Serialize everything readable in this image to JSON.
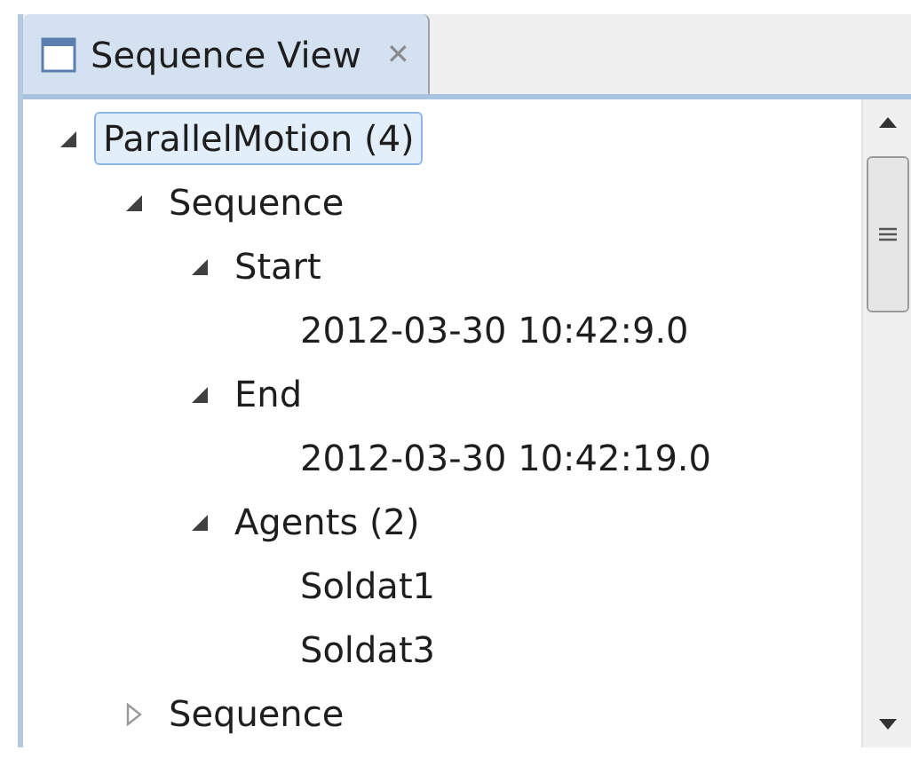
{
  "tab": {
    "title": "Sequence View",
    "close": "✕",
    "selected": true
  },
  "tree": [
    {
      "label": "ParallelMotion (4)",
      "selected": true,
      "expanded": true,
      "children": [
        {
          "label": "Sequence",
          "selected": false,
          "expanded": true,
          "children": [
            {
              "label": "Start",
              "selected": false,
              "expanded": true,
              "children": [
                {
                  "label": "2012-03-30 10:42:9.0",
                  "selected": false
                }
              ]
            },
            {
              "label": "End",
              "selected": false,
              "expanded": true,
              "children": [
                {
                  "label": "2012-03-30 10:42:19.0",
                  "selected": false
                }
              ]
            },
            {
              "label": "Agents (2)",
              "selected": false,
              "expanded": true,
              "children": [
                {
                  "label": "Soldat1",
                  "selected": false
                },
                {
                  "label": "Soldat3",
                  "selected": false
                }
              ]
            }
          ]
        },
        {
          "label": "Sequence",
          "selected": false,
          "expanded": false
        }
      ]
    }
  ]
}
